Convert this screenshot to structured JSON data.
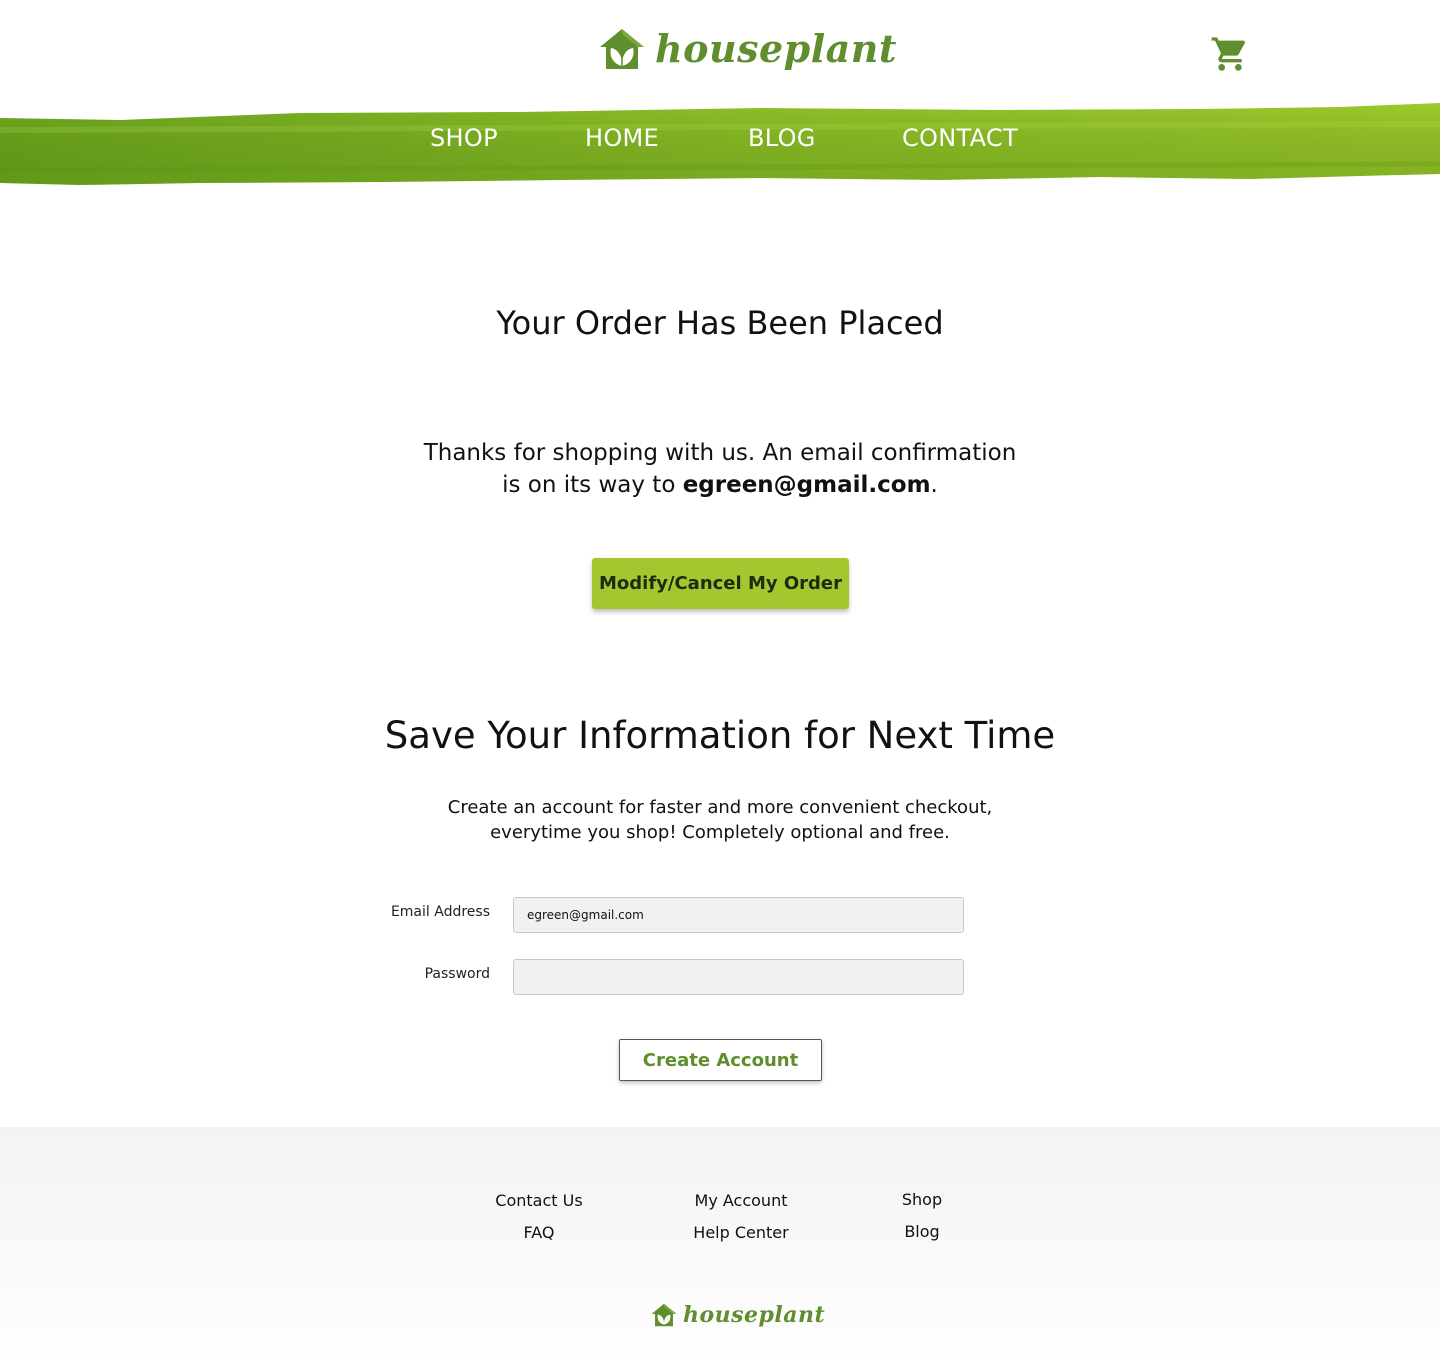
{
  "brand": {
    "name": "houseplant",
    "color": "#5e8e2e",
    "accent": "#a4c72f"
  },
  "header": {
    "cart_icon": "cart-icon"
  },
  "nav": {
    "items": [
      {
        "label": "SHOP"
      },
      {
        "label": "HOME"
      },
      {
        "label": "BLOG"
      },
      {
        "label": "CONTACT"
      }
    ]
  },
  "order": {
    "title": "Your Order Has Been Placed",
    "message_line1": "Thanks for shopping with us. An email confirmation",
    "message_line2_prefix": "is on its way to ",
    "email": "egreen@gmail.com",
    "message_line2_suffix": ".",
    "modify_button": "Modify/Cancel My Order"
  },
  "signup": {
    "title": "Save Your Information for Next Time",
    "desc_line1": "Create an account for faster and more convenient checkout,",
    "desc_line2": "everytime you shop! Completely optional and free.",
    "email_label": "Email Address",
    "email_value": "egreen@gmail.com",
    "password_label": "Password",
    "password_value": "",
    "create_button": "Create Account"
  },
  "footer": {
    "columns": [
      {
        "links": [
          "Contact Us",
          "FAQ"
        ]
      },
      {
        "links": [
          "My Account",
          "Help Center"
        ]
      },
      {
        "links": [
          "Shop",
          "Blog"
        ]
      }
    ],
    "logo_text": "houseplant"
  }
}
